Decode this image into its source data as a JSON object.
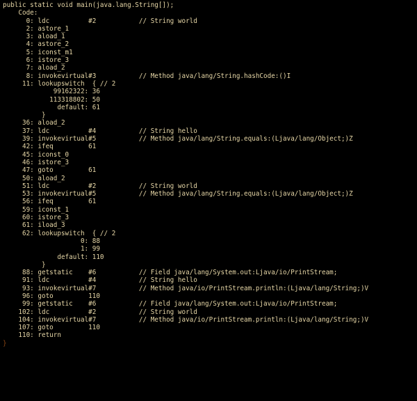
{
  "signature": "public static void main(java.lang.String[]);",
  "code_label": "Code:",
  "cols": {
    "label": 7,
    "mnemonic": 22,
    "arg": 35,
    "comment": 44
  },
  "instructions": [
    {
      "pc": 0,
      "op": "ldc",
      "arg": "#2",
      "comment": "String world"
    },
    {
      "pc": 2,
      "op": "astore_1"
    },
    {
      "pc": 3,
      "op": "aload_1"
    },
    {
      "pc": 4,
      "op": "astore_2"
    },
    {
      "pc": 5,
      "op": "iconst_m1"
    },
    {
      "pc": 6,
      "op": "istore_3"
    },
    {
      "pc": 7,
      "op": "aload_2"
    },
    {
      "pc": 8,
      "op": "invokevirtual",
      "arg": "#3",
      "comment": "Method java/lang/String.hashCode:()I"
    },
    {
      "pc": 11,
      "op": "lookupswitch",
      "inline": "{ // 2",
      "table": [
        {
          "key": "99162322",
          "target": 36
        },
        {
          "key": "113318802",
          "target": 50
        },
        {
          "key": "default",
          "target": 61
        }
      ]
    },
    {
      "pc": 36,
      "op": "aload_2"
    },
    {
      "pc": 37,
      "op": "ldc",
      "arg": "#4",
      "comment": "String hello"
    },
    {
      "pc": 39,
      "op": "invokevirtual",
      "arg": "#5",
      "comment": "Method java/lang/String.equals:(Ljava/lang/Object;)Z"
    },
    {
      "pc": 42,
      "op": "ifeq",
      "argnum": "61"
    },
    {
      "pc": 45,
      "op": "iconst_0"
    },
    {
      "pc": 46,
      "op": "istore_3"
    },
    {
      "pc": 47,
      "op": "goto",
      "argnum": "61"
    },
    {
      "pc": 50,
      "op": "aload_2"
    },
    {
      "pc": 51,
      "op": "ldc",
      "arg": "#2",
      "comment": "String world"
    },
    {
      "pc": 53,
      "op": "invokevirtual",
      "arg": "#5",
      "comment": "Method java/lang/String.equals:(Ljava/lang/Object;)Z"
    },
    {
      "pc": 56,
      "op": "ifeq",
      "argnum": "61"
    },
    {
      "pc": 59,
      "op": "iconst_1"
    },
    {
      "pc": 60,
      "op": "istore_3"
    },
    {
      "pc": 61,
      "op": "iload_3"
    },
    {
      "pc": 62,
      "op": "lookupswitch",
      "inline": "{ // 2",
      "table": [
        {
          "key": "0",
          "target": 88
        },
        {
          "key": "1",
          "target": 99
        },
        {
          "key": "default",
          "target": 110
        }
      ]
    },
    {
      "pc": 88,
      "op": "getstatic",
      "arg": "#6",
      "comment": "Field java/lang/System.out:Ljava/io/PrintStream;"
    },
    {
      "pc": 91,
      "op": "ldc",
      "arg": "#4",
      "comment": "String hello"
    },
    {
      "pc": 93,
      "op": "invokevirtual",
      "arg": "#7",
      "comment": "Method java/io/PrintStream.println:(Ljava/lang/String;)V"
    },
    {
      "pc": 96,
      "op": "goto",
      "argnum": "110"
    },
    {
      "pc": 99,
      "op": "getstatic",
      "arg": "#6",
      "comment": "Field java/lang/System.out:Ljava/io/PrintStream;"
    },
    {
      "pc": 102,
      "op": "ldc",
      "arg": "#2",
      "comment": "String world"
    },
    {
      "pc": 104,
      "op": "invokevirtual",
      "arg": "#7",
      "comment": "Method java/io/PrintStream.println:(Ljava/lang/String;)V"
    },
    {
      "pc": 107,
      "op": "goto",
      "argnum": "110"
    },
    {
      "pc": 110,
      "op": "return"
    }
  ],
  "closing_brace": "}"
}
